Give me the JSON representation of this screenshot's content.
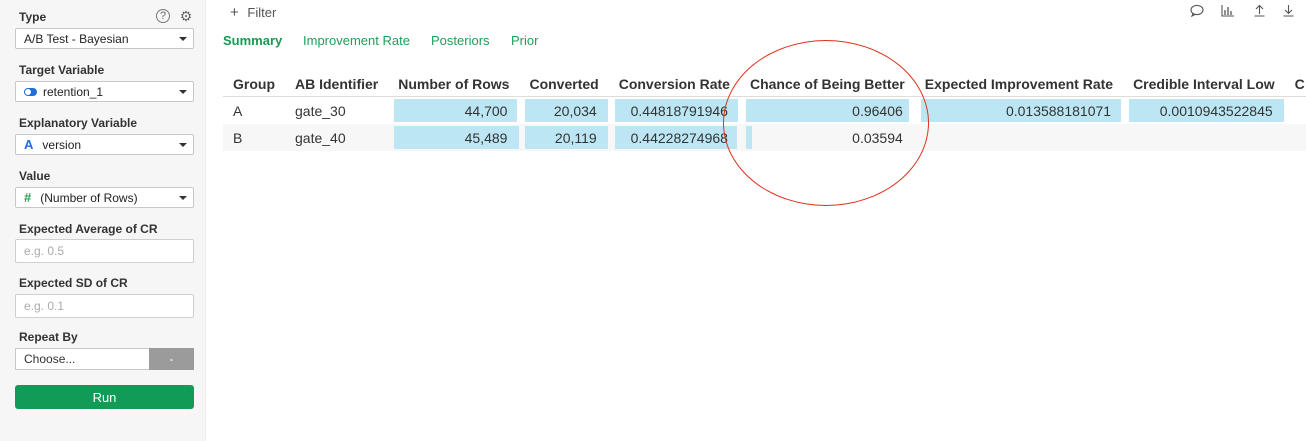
{
  "sidebar": {
    "type_label": "Type",
    "type_value": "A/B Test - Bayesian",
    "target_label": "Target Variable",
    "target_value": "retention_1",
    "explanatory_label": "Explanatory Variable",
    "explanatory_value": "version",
    "explanatory_type_glyph": "A",
    "value_label": "Value",
    "value_value": "(Number of Rows)",
    "value_type_glyph": "#",
    "avg_label": "Expected Average of CR",
    "avg_placeholder": "e.g. 0.5",
    "sd_label": "Expected SD of CR",
    "sd_placeholder": "e.g. 0.1",
    "repeat_label": "Repeat By",
    "repeat_value": "Choose...",
    "repeat_remove": "-",
    "run_label": "Run",
    "help_glyph": "?",
    "settings_glyph": "⚙"
  },
  "main": {
    "filter_label": "Filter",
    "filter_glyph": "+",
    "tabs": [
      {
        "label": "Summary",
        "active": true
      },
      {
        "label": "Improvement Rate",
        "active": false
      },
      {
        "label": "Posteriors",
        "active": false
      },
      {
        "label": "Prior",
        "active": false
      }
    ],
    "icons": [
      "comment-icon",
      "chart-icon",
      "upload-icon",
      "download-icon"
    ]
  },
  "table": {
    "columns": [
      "Group",
      "AB Identifier",
      "Number of Rows",
      "Converted",
      "Conversion Rate",
      "Chance of Being Better",
      "Expected Improvement Rate",
      "Credible Interval Low",
      "C"
    ],
    "rows": [
      {
        "group": "A",
        "id": "gate_30",
        "rows": "44,700",
        "converted": "20,034",
        "rate": "0.44818791946",
        "chance": "0.96406",
        "improvement": "0.013588181071",
        "ci_low": "0.0010943522845",
        "bars": {
          "rows": 0.98,
          "converted": 0.99,
          "rate": 0.99,
          "chance": 0.96406,
          "improvement": 0.99,
          "ci_low": 0.99
        }
      },
      {
        "group": "B",
        "id": "gate_40",
        "rows": "45,489",
        "converted": "20,119",
        "rate": "0.44228274968",
        "chance": "0.03594",
        "improvement": "",
        "ci_low": "",
        "bars": {
          "rows": 1.0,
          "converted": 1.0,
          "rate": 0.98,
          "chance": 0.03594,
          "improvement": 0,
          "ci_low": 0
        }
      }
    ]
  },
  "colors": {
    "accent": "#169a53",
    "bar": "#bce6f4",
    "highlight": "#e0321c"
  }
}
